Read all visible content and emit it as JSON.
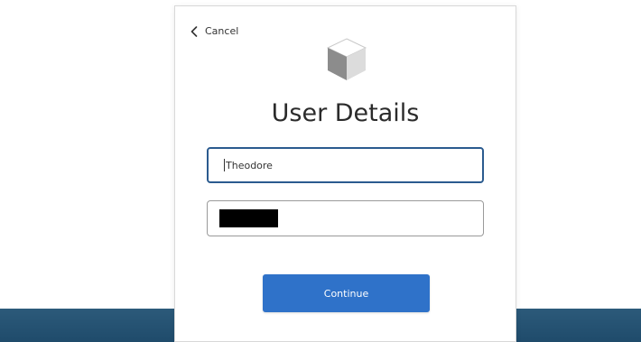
{
  "header": {
    "cancel_label": "Cancel"
  },
  "icons": {
    "back": "chevron-left-icon",
    "logo": "cube-icon"
  },
  "main": {
    "title": "User Details",
    "fields": [
      {
        "value": "Theodore"
      },
      {
        "value": ""
      }
    ],
    "continue_label": "Continue"
  },
  "colors": {
    "primary_button": "#2f72c9",
    "focused_border": "#2b5b8f",
    "bottom_band": "#1f4b6b"
  }
}
